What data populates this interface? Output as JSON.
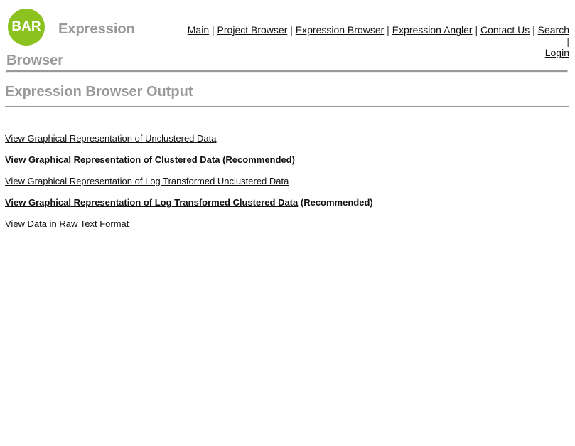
{
  "header": {
    "logo_text": "BAR",
    "site_title": "Expression Browser",
    "nav": [
      {
        "label": "Main"
      },
      {
        "label": "Project Browser"
      },
      {
        "label": "Expression Browser"
      },
      {
        "label": "Expression Angler"
      },
      {
        "label": "Contact Us"
      },
      {
        "label": "Search"
      },
      {
        "label": "Login"
      }
    ],
    "separator": "|"
  },
  "main": {
    "title": "Expression Browser Output",
    "links": [
      {
        "label": "View Graphical Representation of Unclustered Data",
        "note": ""
      },
      {
        "label": "View Graphical Representation of Clustered Data",
        "note": "(Recommended)"
      },
      {
        "label": "View Graphical Representation of Log Transformed Unclustered Data",
        "note": ""
      },
      {
        "label": "View Graphical Representation of Log Transformed Clustered Data",
        "note": "(Recommended)"
      },
      {
        "label": "View Data in Raw Text Format",
        "note": ""
      }
    ]
  },
  "colors": {
    "logo_green": "#8cc21f",
    "title_gray": "#999999",
    "rule_gray": "#999999"
  }
}
